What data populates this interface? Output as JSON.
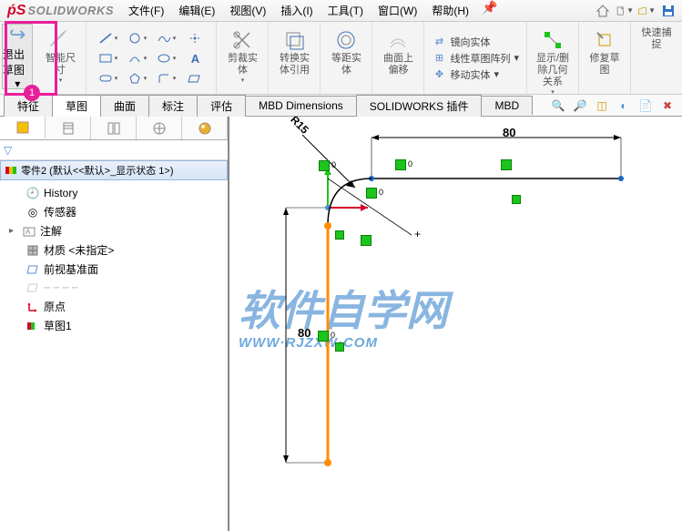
{
  "app": {
    "logo_text": "SOLIDWORKS"
  },
  "menu": {
    "file": "文件(F)",
    "edit": "编辑(E)",
    "view": "视图(V)",
    "insert": "插入(I)",
    "tools": "工具(T)",
    "window": "窗口(W)",
    "help": "帮助(H)"
  },
  "ribbon": {
    "exit_sketch": "退出草图",
    "smart_dim": "智能尺寸",
    "trim": "剪裁实体",
    "convert": "转换实体引用",
    "offset": "等距实体",
    "surface_offset": "曲面上偏移",
    "mirror": "镜向实体",
    "linear_pattern": "线性草图阵列",
    "move": "移动实体",
    "show_hide": "显示/删除几何关系",
    "repair": "修复草图",
    "rapid": "快速捕捉"
  },
  "tabs": {
    "feature": "特征",
    "sketch": "草图",
    "surface": "曲面",
    "annotate": "标注",
    "evaluate": "评估",
    "mbd_dim": "MBD Dimensions",
    "sw_addin": "SOLIDWORKS 插件",
    "mbd": "MBD"
  },
  "tree": {
    "part_header": "零件2  (默认<<默认>_显示状态 1>)",
    "history": "History",
    "sensors": "传感器",
    "annotations": "注解",
    "material": "材质 <未指定>",
    "front_plane": "前视基准面",
    "origin": "原点",
    "sketch1": "草图1"
  },
  "dims": {
    "h80": "80",
    "v80": "80",
    "r15": "R15"
  },
  "highlight": {
    "num": "1"
  },
  "watermark": {
    "main": "软件自学网",
    "sub": "WWW·RJZXW·COM"
  }
}
